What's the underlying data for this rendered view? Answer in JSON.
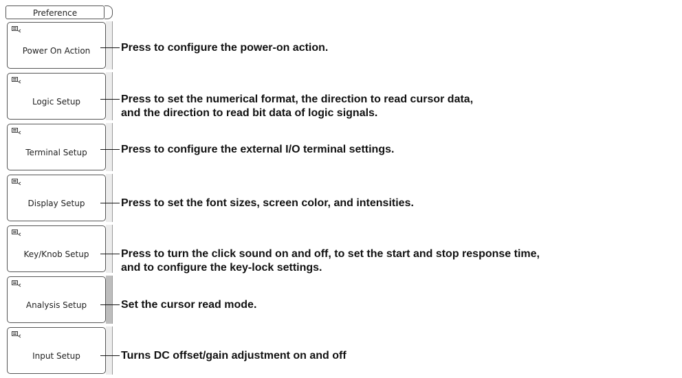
{
  "menu": {
    "title": "Preference"
  },
  "icons": {
    "softkey_icon": "monitor-arrow-icon"
  },
  "items": [
    {
      "label": "Power On Action",
      "desc": [
        "Press to configure the power-on action."
      ]
    },
    {
      "label": "Logic Setup",
      "desc": [
        "Press to set the numerical format, the direction to read cursor data,",
        "and the direction to read bit data of logic signals."
      ]
    },
    {
      "label": "Terminal Setup",
      "desc": [
        "Press to configure the external I/O terminal settings."
      ]
    },
    {
      "label": "Display Setup",
      "desc": [
        "Press to set the font sizes, screen color, and intensities."
      ]
    },
    {
      "label": "Key/Knob Setup",
      "desc": [
        "Press to turn the click sound on and off, to set the start and stop response time,",
        "and to configure the key-lock settings."
      ]
    },
    {
      "label": "Analysis Setup",
      "desc": [
        "Set the cursor read mode."
      ]
    },
    {
      "label": "Input Setup",
      "desc": [
        "Turns DC offset/gain adjustment on and off"
      ]
    }
  ]
}
